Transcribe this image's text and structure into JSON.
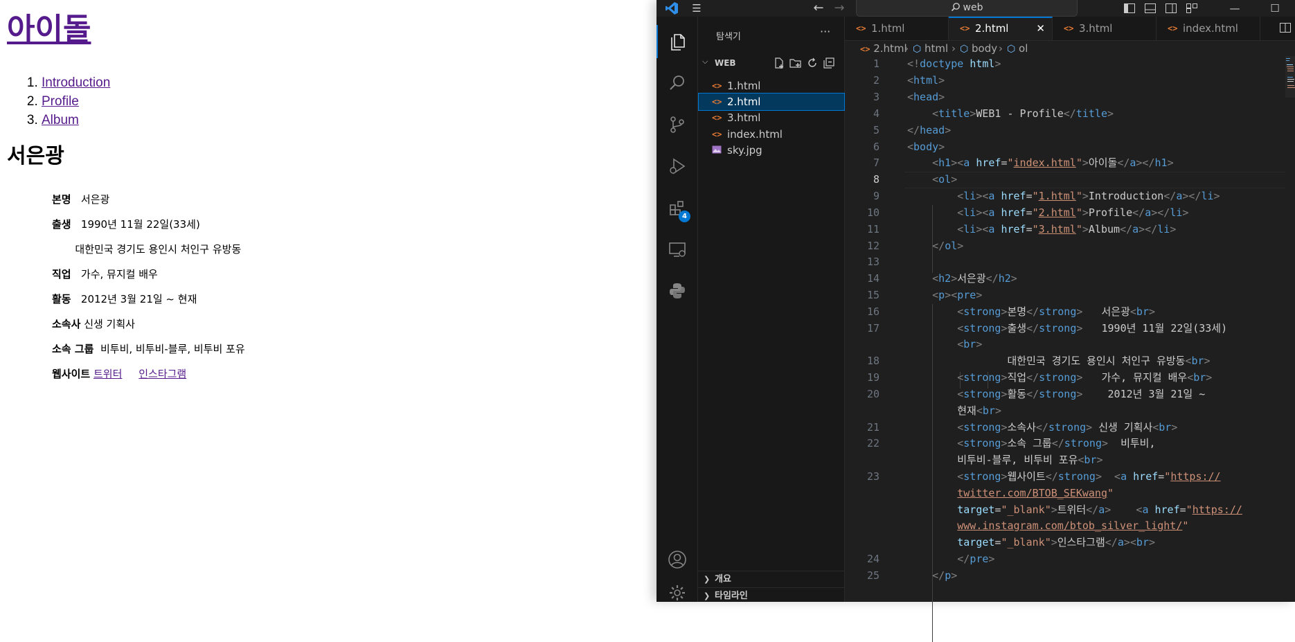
{
  "browser": {
    "heading": "아이돌",
    "nav": [
      "Introduction",
      "Profile",
      "Album"
    ],
    "subheading": "서은광",
    "profile": {
      "name_label": "본명",
      "name_value": "서은광",
      "birth_label": "출생",
      "birth_value": "1990년 11월 22일(33세)",
      "birthplace_value": "대한민국 경기도 용인시 처인구 유방동",
      "job_label": "직업",
      "job_value": "가수, 뮤지컬 배우",
      "activity_label": "활동",
      "activity_value": "2012년 3월 21일 ~ 현재",
      "agency_label": "소속사",
      "agency_value": "신생 기획사",
      "group_label": "소속 그룹",
      "group_value": "비투비, 비투비-블루, 비투비 포유",
      "website_label": "웹사이트",
      "twitter_link": "트위터",
      "instagram_link": "인스타그램"
    }
  },
  "vscode": {
    "search_text": "web",
    "explorer_title": "탐색기",
    "folder_name": "WEB",
    "files": [
      "1.html",
      "2.html",
      "3.html",
      "index.html",
      "sky.jpg"
    ],
    "bottom_panels": [
      "개요",
      "타임라인"
    ],
    "extensions_badge": "4",
    "tabs": [
      "1.html",
      "2.html",
      "3.html",
      "index.html"
    ],
    "breadcrumb": [
      "2.html",
      "html",
      "body",
      "ol"
    ],
    "line_numbers": [
      "1",
      "2",
      "3",
      "4",
      "5",
      "6",
      "7",
      "8",
      "9",
      "10",
      "11",
      "12",
      "13",
      "14",
      "15",
      "16",
      "17",
      "18",
      "19",
      "20",
      "21",
      "22",
      "23",
      "24",
      "25"
    ],
    "code": {
      "title_text": "WEB1 - Profile",
      "h1_href": "index.html",
      "h1_text": "아이돌",
      "li1_href": "1.html",
      "li1_text": "Introduction",
      "li2_href": "2.html",
      "li2_text": "Profile",
      "li3_href": "3.html",
      "li3_text": "Album",
      "h2_text": "서은광",
      "s1": "본명",
      "v1": "   서은광",
      "s2": "출생",
      "v2": "   1990년 11월 22일(33세)",
      "v2b": "        대한민국 경기도 용인시 처인구 유방동",
      "s3": "직업",
      "v3": "   가수, 뮤지컬 배우",
      "s4": "활동",
      "v4": "    2012년 3월 21일 ~",
      "v4b": "현재",
      "s5": "소속사",
      "v5": " 신생 기획사",
      "s6": "소속 그룹",
      "v6": "  비투비,",
      "v6b": "비투비-블루, 비투비 포유",
      "s7": "웹사이트",
      "tw_url_1": "https://",
      "tw_url_2": "twitter.com/BTOB_SEKwang",
      "blank": "_blank",
      "tw_text": "트위터",
      "ig_url_1": "https://",
      "ig_url_2": "www.instagram.com/btob_silver_light/",
      "ig_text": "인스타그램"
    }
  }
}
